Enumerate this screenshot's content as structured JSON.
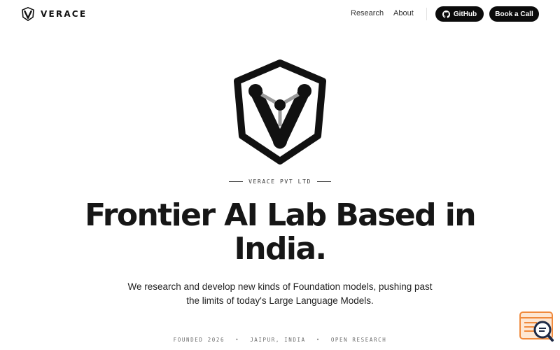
{
  "header": {
    "brand_name": "VERACE",
    "nav": [
      {
        "label": "Research"
      },
      {
        "label": "About"
      }
    ],
    "github_label": "GitHub",
    "cta_label": "Book a Call"
  },
  "hero": {
    "eyebrow": "VERACE PVT LTD",
    "headline_line1": "Frontier AI Lab Based in",
    "headline_line2": "India.",
    "subtitle_line1": "We research and develop new kinds of Foundation models, pushing past",
    "subtitle_line2": "the limits of today's Large Language Models."
  },
  "meta": {
    "items": [
      "FOUNDED 2026",
      "JAIPUR, INDIA",
      "OPEN RESEARCH"
    ],
    "separator": "•"
  },
  "icons": {
    "brand_logo": "verace-shield-logo-icon",
    "hero_logo": "verace-shield-logo-icon",
    "github": "github-icon",
    "widget": "search-chat-widget-icon"
  },
  "colors": {
    "text": "#111827",
    "button_bg": "#0b0b0b",
    "button_text": "#ffffff",
    "widget_accent": "#f08a3c"
  }
}
